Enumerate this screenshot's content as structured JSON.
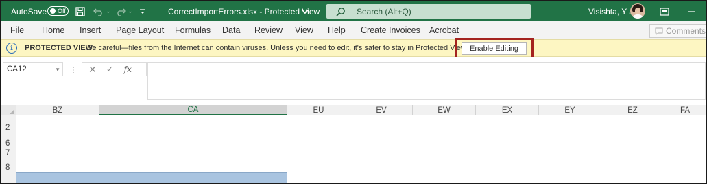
{
  "title_bar": {
    "autosave_label": "AutoSave",
    "autosave_state": "Off",
    "filename": "CorrectImportErrors.xlsx  -  Protected View",
    "search_placeholder": "Search (Alt+Q)",
    "user_name": "Visishta, Y J",
    "icons": [
      "save-icon",
      "undo-icon",
      "redo-icon",
      "customize-toolbar-icon",
      "search-icon",
      "avatar",
      "ribbon-display-icon",
      "minimize-icon"
    ]
  },
  "menu": {
    "items": [
      "File",
      "Home",
      "Insert",
      "Page Layout",
      "Formulas",
      "Data",
      "Review",
      "View",
      "Help",
      "Create Invoices",
      "Acrobat"
    ],
    "comments_label": "Comments"
  },
  "protected_view": {
    "title": "PROTECTED VIEW",
    "message": "Be careful—files from the Internet can contain viruses. Unless you need to edit, it's safer to stay in Protected View.",
    "button_label": "Enable Editing",
    "highlight_color": "#a4231f"
  },
  "formula_bar": {
    "name_box": "CA12",
    "formula": ""
  },
  "grid": {
    "columns": [
      "BZ",
      "CA",
      "EU",
      "EV",
      "EW",
      "EX",
      "EY",
      "EZ",
      "FA"
    ],
    "selected_column": "CA",
    "rows": [
      "2",
      "6",
      "7",
      "8"
    ]
  },
  "colors": {
    "title_bar": "#217346",
    "protected_bar": "#fdf6c2",
    "selection_fill": "#a9c4e0"
  }
}
